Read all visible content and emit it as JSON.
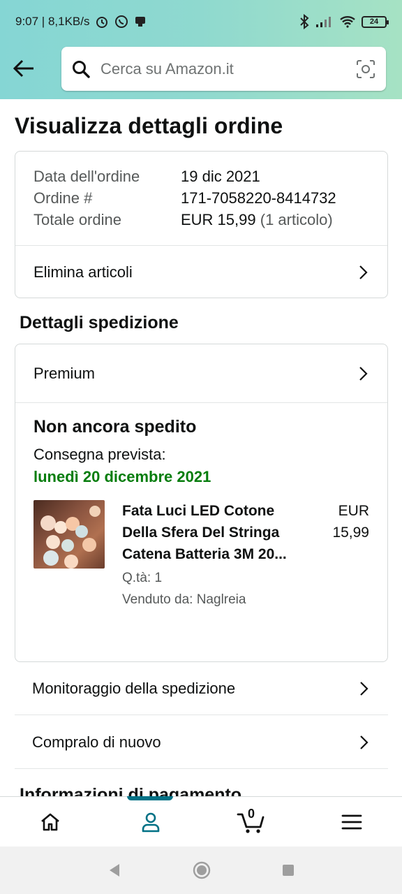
{
  "status_bar": {
    "time_speed": "9:07 | 8,1KB/s",
    "battery": "24"
  },
  "search": {
    "placeholder": "Cerca su Amazon.it"
  },
  "page_title": "Visualizza dettagli ordine",
  "order_summary": {
    "date_label": "Data dell'ordine",
    "date_value": "19 dic 2021",
    "order_label": "Ordine #",
    "order_value": "171-7058220-8414732",
    "total_label": "Totale ordine",
    "total_value": "EUR 15,99",
    "total_items": "(1 articolo)",
    "delete_items": "Elimina articoli"
  },
  "shipping": {
    "section_title": "Dettagli spedizione",
    "method": "Premium",
    "status": "Non ancora spedito",
    "delivery_label": "Consegna prevista:",
    "delivery_date": "lunedì 20 dicembre 2021",
    "item": {
      "title": "Fata Luci LED Cotone Della Sfera Del Stringa Catena Batteria 3M 20...",
      "quantity": "Q.tà: 1",
      "seller": "Venduto da: Naglreia",
      "price_currency": "EUR",
      "price_value": "15,99"
    }
  },
  "actions": {
    "track": "Monitoraggio della spedizione",
    "buy_again": "Compralo di nuovo"
  },
  "payment_title": "Informazioni di pagamento",
  "bottom_nav": {
    "cart_count": "0",
    "active": "account"
  },
  "colors": {
    "accent": "#007185",
    "delivery_green": "#067d0d"
  }
}
